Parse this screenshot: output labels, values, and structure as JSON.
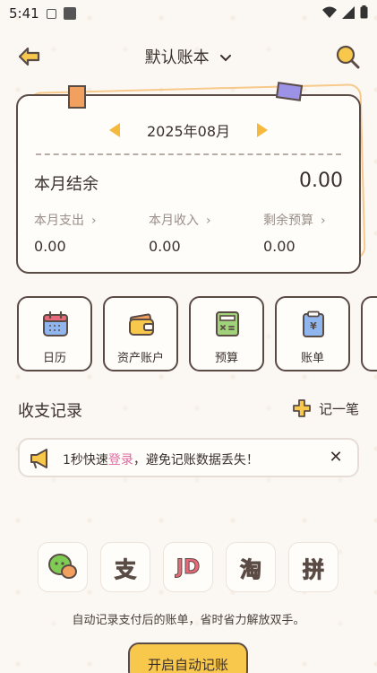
{
  "status_bar": {
    "time": "5:41"
  },
  "header": {
    "title": "默认账本"
  },
  "summary": {
    "month": "2025年08月",
    "balance_label": "本月结余",
    "balance_value": "0.00",
    "stats": [
      {
        "label": "本月支出",
        "value": "0.00"
      },
      {
        "label": "本月收入",
        "value": "0.00"
      },
      {
        "label": "剩余预算",
        "value": "0.00"
      }
    ]
  },
  "quick_menu": [
    {
      "label": "日历",
      "icon": "calendar-icon"
    },
    {
      "label": "资产账户",
      "icon": "wallet-icon"
    },
    {
      "label": "预算",
      "icon": "calculator-icon"
    },
    {
      "label": "账单",
      "icon": "bill-icon"
    },
    {
      "label": "",
      "icon": "more-icon"
    }
  ],
  "records": {
    "title": "收支记录",
    "add_label": "记一笔"
  },
  "notice": {
    "prefix": "1秒快速",
    "link": "登录",
    "suffix": "，避免记账数据丢失！"
  },
  "apps": [
    {
      "icon": "wechat-icon",
      "text": ""
    },
    {
      "icon": "alipay-icon",
      "text": "支"
    },
    {
      "icon": "jd-icon",
      "text": "JD"
    },
    {
      "icon": "taobao-icon",
      "text": "淘"
    },
    {
      "icon": "pinduoduo-icon",
      "text": "拼"
    }
  ],
  "auto_record": {
    "description": "自动记录支付后的账单，省时省力解放双手。",
    "button": "开启自动记账"
  },
  "colors": {
    "accent": "#f8c84c",
    "link": "#e06aa0",
    "outline": "#5a4b45"
  }
}
